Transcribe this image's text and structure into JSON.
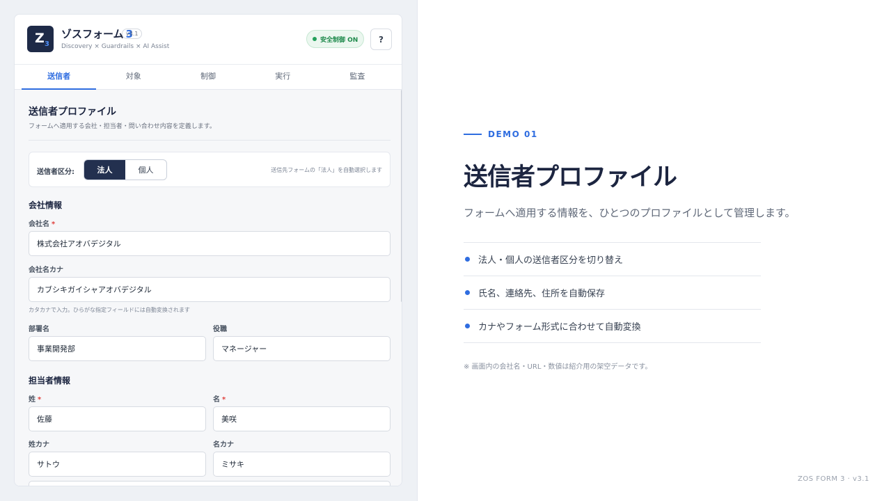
{
  "header": {
    "logo_letter": "Z",
    "logo_sub": "3",
    "app_name": "ゾスフォーム",
    "app_number": "3",
    "version": "v3.1",
    "subtitle": "Discovery × Guardrails × AI Assist",
    "safety_label": "安全制御 ON",
    "help_label": "?"
  },
  "tabs": [
    {
      "label": "送信者",
      "active": true
    },
    {
      "label": "対象",
      "active": false
    },
    {
      "label": "制御",
      "active": false
    },
    {
      "label": "実行",
      "active": false
    },
    {
      "label": "監査",
      "active": false
    }
  ],
  "section": {
    "title": "送信者プロファイル",
    "description": "フォームへ適用する会社・担当者・問い合わせ内容を定義します。"
  },
  "sender_type": {
    "label": "送信者区分:",
    "options": [
      "法人",
      "個人"
    ],
    "selected": "法人",
    "hint": "送信先フォームの「法人」を自動選択します"
  },
  "company": {
    "group_title": "会社情報",
    "name_label": "会社名",
    "name_value": "株式会社アオバデジタル",
    "kana_label": "会社名カナ",
    "kana_value": "カブシキガイシャアオバデジタル",
    "kana_note": "カタカナで入力。ひらがな指定フィールドには自動変換されます",
    "dept_label": "部署名",
    "dept_value": "事業開発部",
    "position_label": "役職",
    "position_value": "マネージャー"
  },
  "contact": {
    "group_title": "担当者情報",
    "last_label": "姓",
    "last_value": "佐藤",
    "first_label": "名",
    "first_value": "美咲",
    "last_kana_label": "姓カナ",
    "last_kana_value": "サトウ",
    "first_kana_label": "名カナ",
    "first_kana_value": "ミサキ"
  },
  "required_mark": "*",
  "promo": {
    "demo_label": "DEMO 01",
    "title": "送信者プロファイル",
    "subtitle": "フォームへ適用する情報を、ひとつのプロファイルとして管理します。",
    "features": [
      "法人・個人の送信者区分を切り替え",
      "氏名、連絡先、住所を自動保存",
      "カナやフォーム形式に合わせて自動変換"
    ],
    "footnote": "※ 画面内の会社名・URL・数値は紹介用の架空データです。",
    "corner": "ZOS FORM 3 · v3.1"
  },
  "colors": {
    "accent": "#2f6de0",
    "navy": "#1e2a47",
    "safe_green": "#1f8a4c",
    "required_red": "#e0413d"
  }
}
